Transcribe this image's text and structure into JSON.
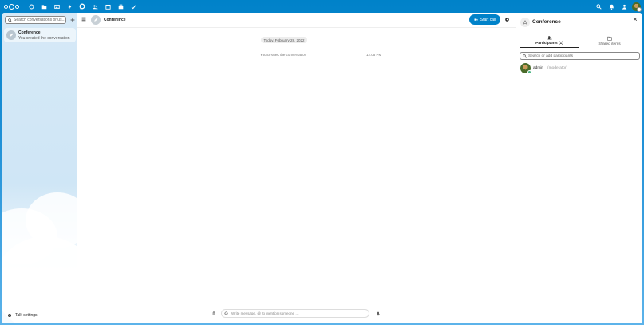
{
  "topbar": {
    "apps": [
      "dashboard",
      "files",
      "photos",
      "activity",
      "talk",
      "contacts",
      "calendar",
      "deck",
      "tasks"
    ],
    "right_icons": [
      "search",
      "notifications",
      "contacts-menu"
    ]
  },
  "nav": {
    "search_placeholder": "Search conversations or us...",
    "conversation": {
      "name": "Conference",
      "last_message": "You created the conversation"
    },
    "settings_label": "Talk settings"
  },
  "chat": {
    "title": "Conference",
    "start_call_label": "Start call",
    "date_separator": "Today, February 28, 2022",
    "system_message": "You created the conversation",
    "system_time": "12:05 PM",
    "composer_placeholder": "Write message, @ to mention someone …"
  },
  "sidebar": {
    "title": "Conference",
    "tabs": [
      {
        "label": "Participants (1)",
        "active": true
      },
      {
        "label": "Shared items",
        "active": false
      }
    ],
    "participant_search_placeholder": "Search or add participants",
    "participants": [
      {
        "name": "admin",
        "role": "(moderator)",
        "status": "online"
      }
    ]
  },
  "colors": {
    "brand": "#0082c9",
    "online": "#49b382"
  }
}
